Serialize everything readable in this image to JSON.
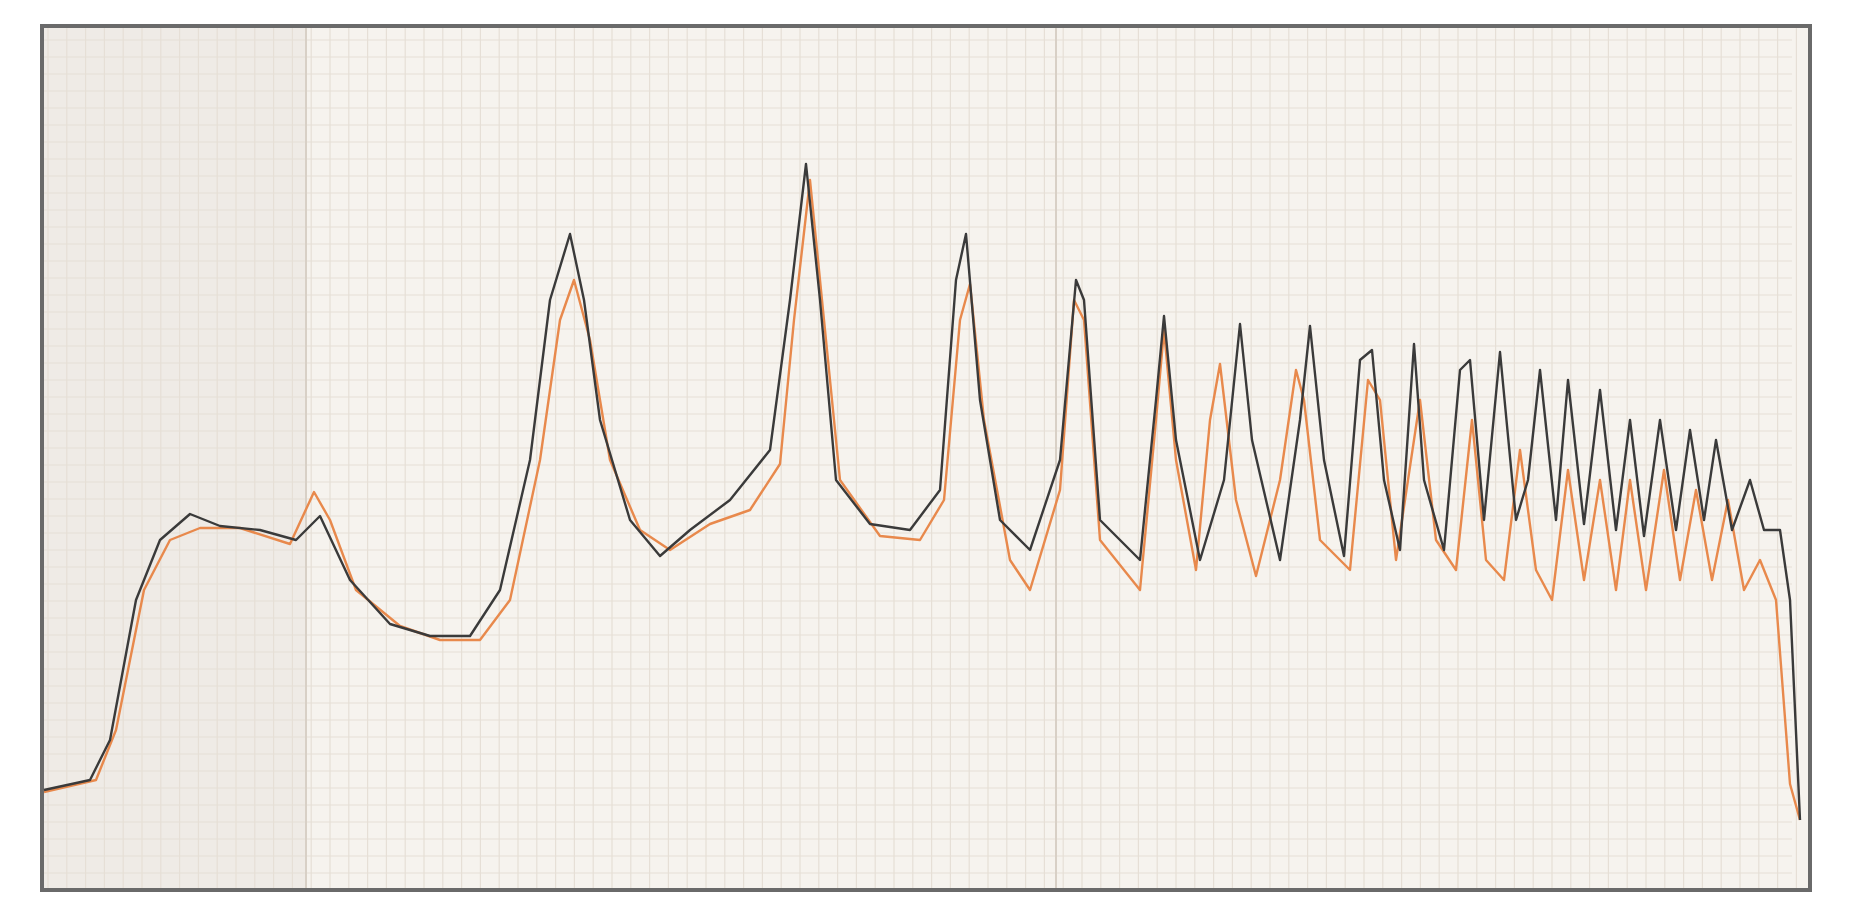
{
  "plot": {
    "traces": [
      {
        "color": "#3a3a3a"
      },
      {
        "color": "#e8894c"
      }
    ]
  }
}
